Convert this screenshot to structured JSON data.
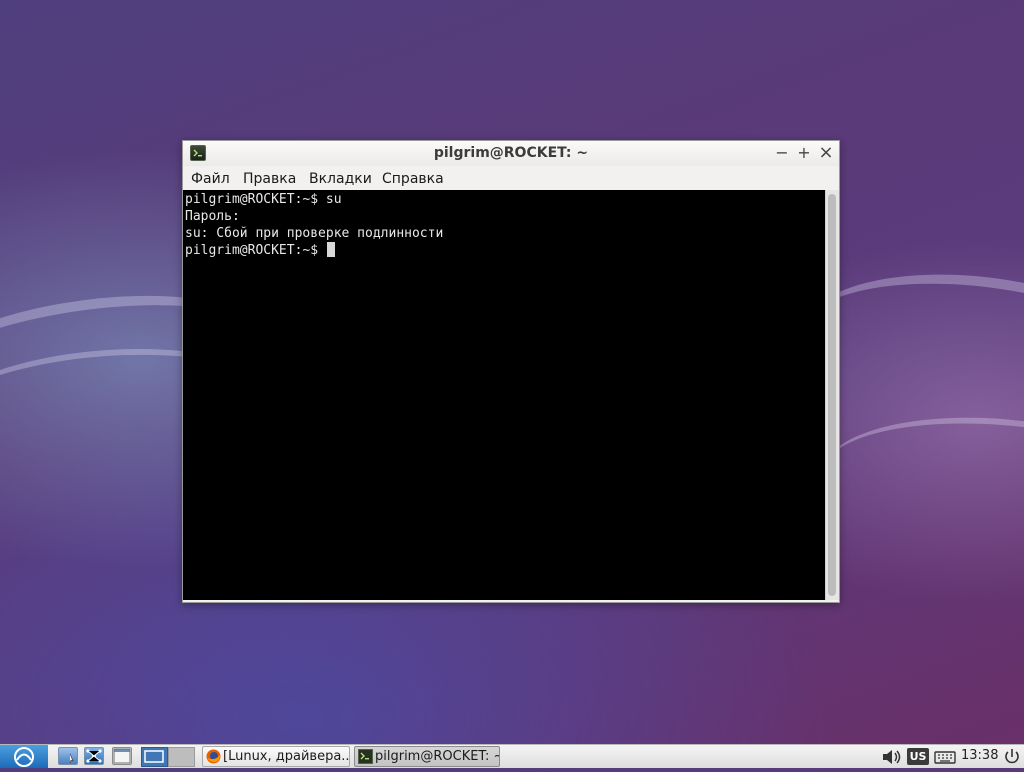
{
  "window": {
    "title": "pilgrim@ROCKET: ~",
    "controls": {
      "minimize": "−",
      "maximize": "+",
      "close": "×"
    }
  },
  "menu": {
    "items": [
      {
        "label": "Файл"
      },
      {
        "label": "Правка"
      },
      {
        "label": "Вкладки"
      },
      {
        "label": "Справка"
      }
    ]
  },
  "terminal": {
    "lines": [
      "pilgrim@ROCKET:~$ su",
      "Пароль:",
      "su: Сбой при проверке подлинности",
      "pilgrim@ROCKET:~$ "
    ]
  },
  "taskbar": {
    "tasks": [
      {
        "label": "[Lunux, драйвера..."
      },
      {
        "label": "pilgrim@ROCKET: ~"
      }
    ],
    "keyboard_layout": "US",
    "clock": "13:38",
    "icons": [
      "start-menu-icon",
      "file-manager-icon",
      "network-icon",
      "window-icon",
      "desktop-workspace-icon",
      "volume-icon",
      "keyboard-icon",
      "power-icon"
    ]
  },
  "colors": {
    "terminal_bg": "#000000",
    "terminal_fg": "#e8e8e8",
    "start_button": "#2f86cf"
  }
}
